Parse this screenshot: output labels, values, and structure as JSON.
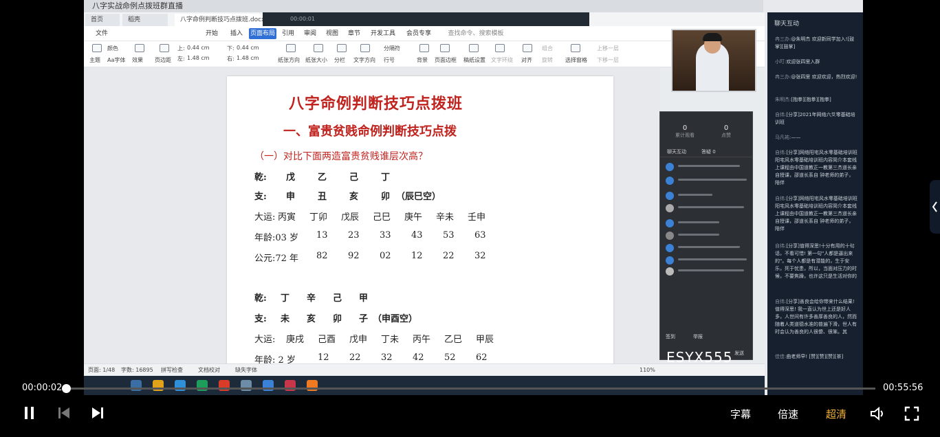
{
  "window": {
    "title": "八字实战命例点拨班群直播"
  },
  "tabs": [
    {
      "label": "首页"
    },
    {
      "label": "稻壳"
    },
    {
      "label": "八字命例判断技巧点拨班.docx"
    }
  ],
  "meeting": {
    "status": "00:00:01"
  },
  "menu": [
    "文件",
    "开始",
    "插入",
    "页面布局",
    "引用",
    "审阅",
    "视图",
    "章节",
    "开发工具",
    "会员专享"
  ],
  "search": {
    "placeholder": "查找命令、搜索模板"
  },
  "ribbon": {
    "theme": "主题",
    "color": "颜色",
    "font": "Aa字体",
    "effect": "效果",
    "margin": "页边距",
    "top_label": "上:",
    "top_val": "0.44 cm",
    "bottom_label": "下:",
    "bottom_val": "0.44 cm",
    "left_label": "左:",
    "left_val": "1.48 cm",
    "right_label": "右:",
    "right_val": "1.48 cm",
    "orientation": "纸张方向",
    "size": "纸张大小",
    "columns": "分栏",
    "text_dir": "文字方向",
    "line_num": "行号",
    "breaks": "分隔符",
    "background": "背景",
    "border": "页面边框",
    "paper": "稿纸设置",
    "wrap": "文字环绕",
    "align": "对齐",
    "rotate": "旋转",
    "select": "选择窗格",
    "up": "上移一层",
    "down": "下移一层",
    "group": "组合"
  },
  "document": {
    "title": "八字命例判断技巧点拨班",
    "section": "一、富贵贫贱命例判断技巧点拨",
    "question": "（一）对比下面两造富贵贫贱谁层次高？",
    "chart1": {
      "qian_label": "乾:",
      "qian": [
        "戊",
        "乙",
        "己",
        "丁"
      ],
      "zhi_label": "支:",
      "zhi": [
        "申",
        "丑",
        "亥",
        "卯"
      ],
      "zhi_note": "（辰巳空）",
      "dayun_label": "大运:",
      "dayun": [
        "丙寅",
        "丁卯",
        "戊辰",
        "己巳",
        "庚午",
        "辛未",
        "壬申"
      ],
      "age_label": "年龄:03 岁",
      "ages": [
        "13",
        "23",
        "33",
        "43",
        "53",
        "63"
      ],
      "year_label": "公元:72 年",
      "years": [
        "82",
        "92",
        "02",
        "12",
        "22",
        "32"
      ]
    },
    "chart2": {
      "qian_label": "乾:",
      "qian": [
        "丁",
        "辛",
        "己",
        "甲"
      ],
      "zhi_label": "支:",
      "zhi": [
        "未",
        "亥",
        "卯",
        "子"
      ],
      "zhi_note": "（申酉空）",
      "dayun_label": "大运:",
      "dayun": [
        "庚戌",
        "己酉",
        "戊申",
        "丁未",
        "丙午",
        "乙巳",
        "甲辰"
      ],
      "age_label": "年龄: 2 岁",
      "ages": [
        "12",
        "22",
        "32",
        "42",
        "52",
        "62"
      ]
    }
  },
  "statusbar": {
    "page": "页面: 1/48",
    "words": "字数: 16895",
    "spell": "拼写检查",
    "proof": "文档校对",
    "missing_font": "缺失字体",
    "zoom": "110%"
  },
  "inner_chat": {
    "stat1_val": "0",
    "stat1_label": "累计观看",
    "stat2_val": "0",
    "stat2_label": "点赞",
    "tab1": "聊天互动",
    "tab2": "答疑 0",
    "bottom1": "签到",
    "bottom2": "举报",
    "send": "发送"
  },
  "watermark": "ESYX555",
  "sidebar": {
    "header": "聊天互动",
    "messages": [
      {
        "name": "冉三办:",
        "text": "@朱明杰 欢迎新同学加入![鼓掌][鼓掌]"
      },
      {
        "name": "小叮:",
        "text": "欢迎张四里入群"
      },
      {
        "name": "冉三办:",
        "text": "@张四里 欢迎欢迎，热烈欢迎!"
      },
      {
        "name": "朱明杰:",
        "text": "[抱拳][抱拳][抱拳]"
      },
      {
        "name": "自纬:",
        "text": "[分享]2021年网络六爻零基础培训班"
      },
      {
        "name": "马凡祐:",
        "text": "——"
      },
      {
        "name": "自纬:",
        "text": "[分享]网络阳宅风水零基础培训班 阳宅风水零基础培训班内容简介本套线上课程由中国道教正一教第三杰道长亲自授课，邵道长系自 钟老师的弟子，陪伴"
      },
      {
        "name": "自纬:",
        "text": "[分享]网络阳宅风水零基础培训班 阳宅风水零基础培训班内容简介本套线上课程由中国道教正一教第三杰道长亲自授课，邵道长系自 钟老师的弟子，陪伴"
      },
      {
        "name": "自纬:",
        "text": "[分享]值得深思!十分有用的十句话，不看可惜! 第一句\"人都是逼出来的\"。每个人都是有潜能的，生于安乐，死于忧患，所以，当面对压力的时候，不要焦躁，也许这只是生活对你的"
      },
      {
        "name": "自纬:",
        "text": "[分享]善良会给你带来什么结果! 值得深思! 我一直认为世上还是好人多，人世间有许多善厚善良的人，然而随着人类道德水准的普遍下滑，世人有时会认为善良的人很傻、很笨。其"
      },
      {
        "name": "佳佳:",
        "text": "曲老师早! [赞][赞][赞][茶]"
      }
    ]
  },
  "player": {
    "current": "00:00:02",
    "duration": "00:55:56",
    "progress": 0.0006,
    "subtitles": "字幕",
    "speed": "倍速",
    "quality": "超清"
  }
}
